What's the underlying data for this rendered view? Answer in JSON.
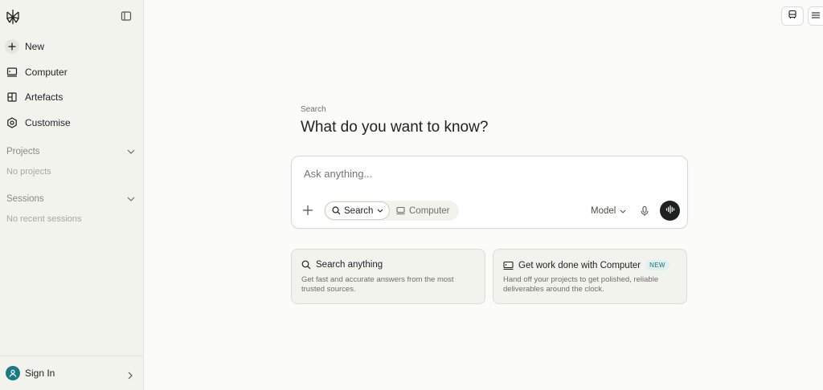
{
  "sidebar": {
    "items": [
      {
        "label": "New",
        "icon": "plus-icon"
      },
      {
        "label": "Computer",
        "icon": "computer-icon"
      },
      {
        "label": "Artefacts",
        "icon": "artefacts-icon"
      },
      {
        "label": "Customise",
        "icon": "customise-icon"
      }
    ],
    "projects": {
      "label": "Projects",
      "empty": "No projects"
    },
    "sessions": {
      "label": "Sessions",
      "empty": "No recent sessions"
    },
    "footer": {
      "label": "Sign In"
    }
  },
  "main": {
    "label": "Search",
    "title": "What do you want to know?",
    "composer": {
      "placeholder": "Ask anything...",
      "mode_search": "Search",
      "mode_computer": "Computer",
      "model": "Model"
    },
    "cards": [
      {
        "title": "Search anything",
        "description": "Get fast and accurate answers from the most trusted sources."
      },
      {
        "title": "Get work done with Computer",
        "badge": "NEW",
        "description": "Hand off your projects to get polished, reliable deliverables around the clock."
      }
    ]
  },
  "colors": {
    "accent": "#1a7b85",
    "dark_button": "#1f2020",
    "sidebar_bg": "#f3f3ee"
  }
}
